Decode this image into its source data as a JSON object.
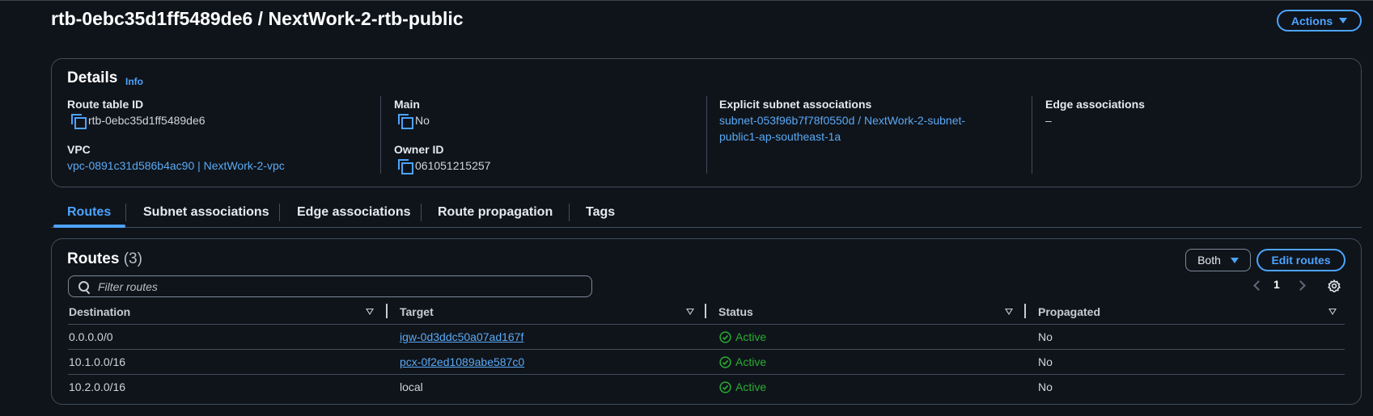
{
  "header": {
    "title": "rtb-0ebc35d1ff5489de6 / NextWork-2-rtb-public",
    "actions_label": "Actions"
  },
  "details": {
    "heading": "Details",
    "info_label": "Info",
    "route_table_id_label": "Route table ID",
    "route_table_id": "rtb-0ebc35d1ff5489de6",
    "vpc_label": "VPC",
    "vpc_value": "vpc-0891c31d586b4ac90 | NextWork-2-vpc",
    "main_label": "Main",
    "main_value": "No",
    "owner_label": "Owner ID",
    "owner_value": "061051215257",
    "explicit_label": "Explicit subnet associations",
    "explicit_line1": "subnet-053f96b7f78f0550d / NextWork-2-subnet-",
    "explicit_line2": "public1-ap-southeast-1a",
    "edge_label": "Edge associations",
    "edge_value": "–"
  },
  "tabs": [
    {
      "label": "Routes",
      "active": true
    },
    {
      "label": "Subnet associations",
      "active": false
    },
    {
      "label": "Edge associations",
      "active": false
    },
    {
      "label": "Route propagation",
      "active": false
    },
    {
      "label": "Tags",
      "active": false
    }
  ],
  "routes": {
    "heading": "Routes",
    "count": "(3)",
    "filter_selected": "Both",
    "edit_label": "Edit routes",
    "search_placeholder": "Filter routes",
    "page": "1",
    "columns": [
      "Destination",
      "Target",
      "Status",
      "Propagated"
    ],
    "rows": [
      {
        "destination": "0.0.0.0/0",
        "target": "igw-0d3ddc50a07ad167f",
        "target_is_link": true,
        "status": "Active",
        "propagated": "No"
      },
      {
        "destination": "10.1.0.0/16",
        "target": "pcx-0f2ed1089abe587c0",
        "target_is_link": true,
        "status": "Active",
        "propagated": "No"
      },
      {
        "destination": "10.2.0.0/16",
        "target": "local",
        "target_is_link": false,
        "status": "Active",
        "propagated": "No"
      }
    ]
  },
  "colors": {
    "background": "#0f141a",
    "accent": "#4da3ff",
    "link": "#5aa9f5",
    "success": "#29ad32",
    "border": "#414d5c"
  },
  "icons": [
    "copy-icon",
    "search-icon",
    "gear-icon",
    "check-circle-icon",
    "chevron-left-icon",
    "chevron-right-icon",
    "caret-down-icon"
  ]
}
